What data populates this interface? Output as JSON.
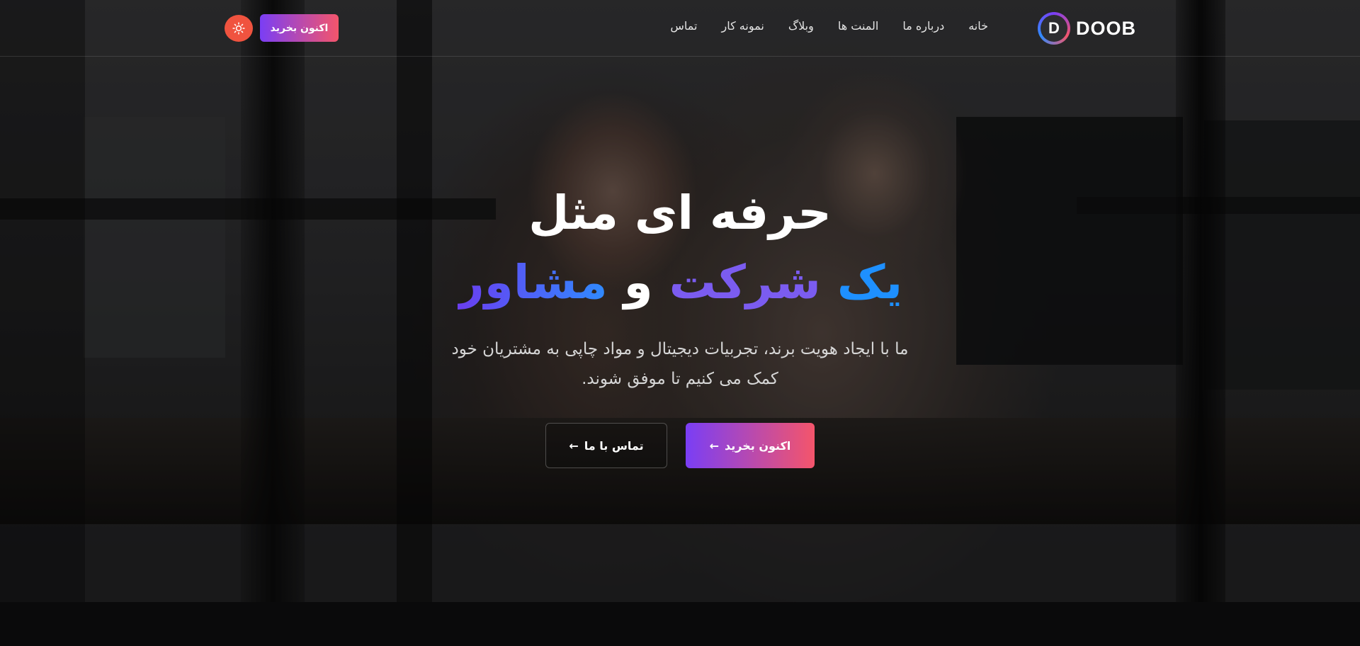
{
  "brand": {
    "logo_letter": "D",
    "name": "DOOB"
  },
  "nav": {
    "items": [
      {
        "label": "خانه"
      },
      {
        "label": "درباره ما"
      },
      {
        "label": "المنت ها"
      },
      {
        "label": "وبلاگ"
      },
      {
        "label": "نمونه کار"
      },
      {
        "label": "تماس"
      }
    ]
  },
  "header": {
    "buy_label": "اکنون بخرید"
  },
  "hero": {
    "title_line1": "حرفه ای مثل",
    "title_line2_part1": "یک",
    "title_line2_part2": "شرکت",
    "title_line2_part3": "و",
    "title_line2_part4": "مشاور",
    "subtitle_line1": "ما با ایجاد هویت برند، تجربیات دیجیتال و مواد چاپی به مشتریان خود",
    "subtitle_line2": "کمک می کنیم تا موفق شوند.",
    "buy_button": "اکنون بخرید",
    "contact_button": "تماس با ما",
    "arrow_glyph": "←"
  },
  "colors": {
    "gradient_start": "#7a3ef5",
    "gradient_end": "#f4556b",
    "accent_blue": "#1e90ff",
    "accent_purple": "#7b5cf0",
    "theme_toggle": "#f0533f"
  },
  "icons": {
    "theme_toggle": "sun-icon",
    "button_arrow": "arrow-left-icon"
  }
}
